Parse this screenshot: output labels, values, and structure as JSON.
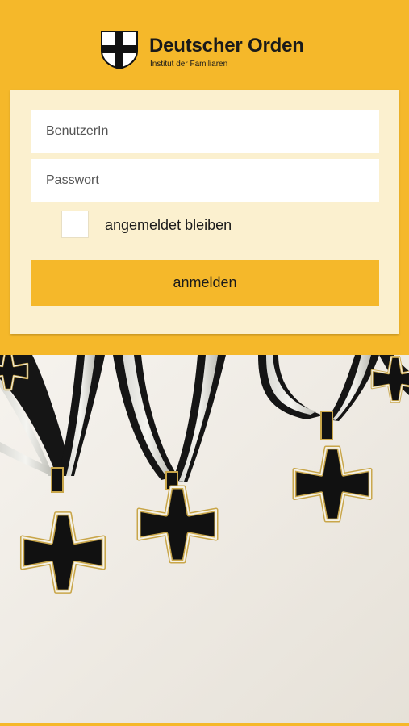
{
  "header": {
    "title": "Deutscher Orden",
    "subtitle": "Institut der Familiaren",
    "logo_icon": "shield-cross-icon"
  },
  "login": {
    "username_placeholder": "BenutzerIn",
    "password_placeholder": "Passwort",
    "remember_label": "angemeldet bleiben",
    "submit_label": "anmelden"
  },
  "colors": {
    "accent": "#f5b82a",
    "card_bg": "#fbf0cf",
    "cross": "#111111"
  }
}
